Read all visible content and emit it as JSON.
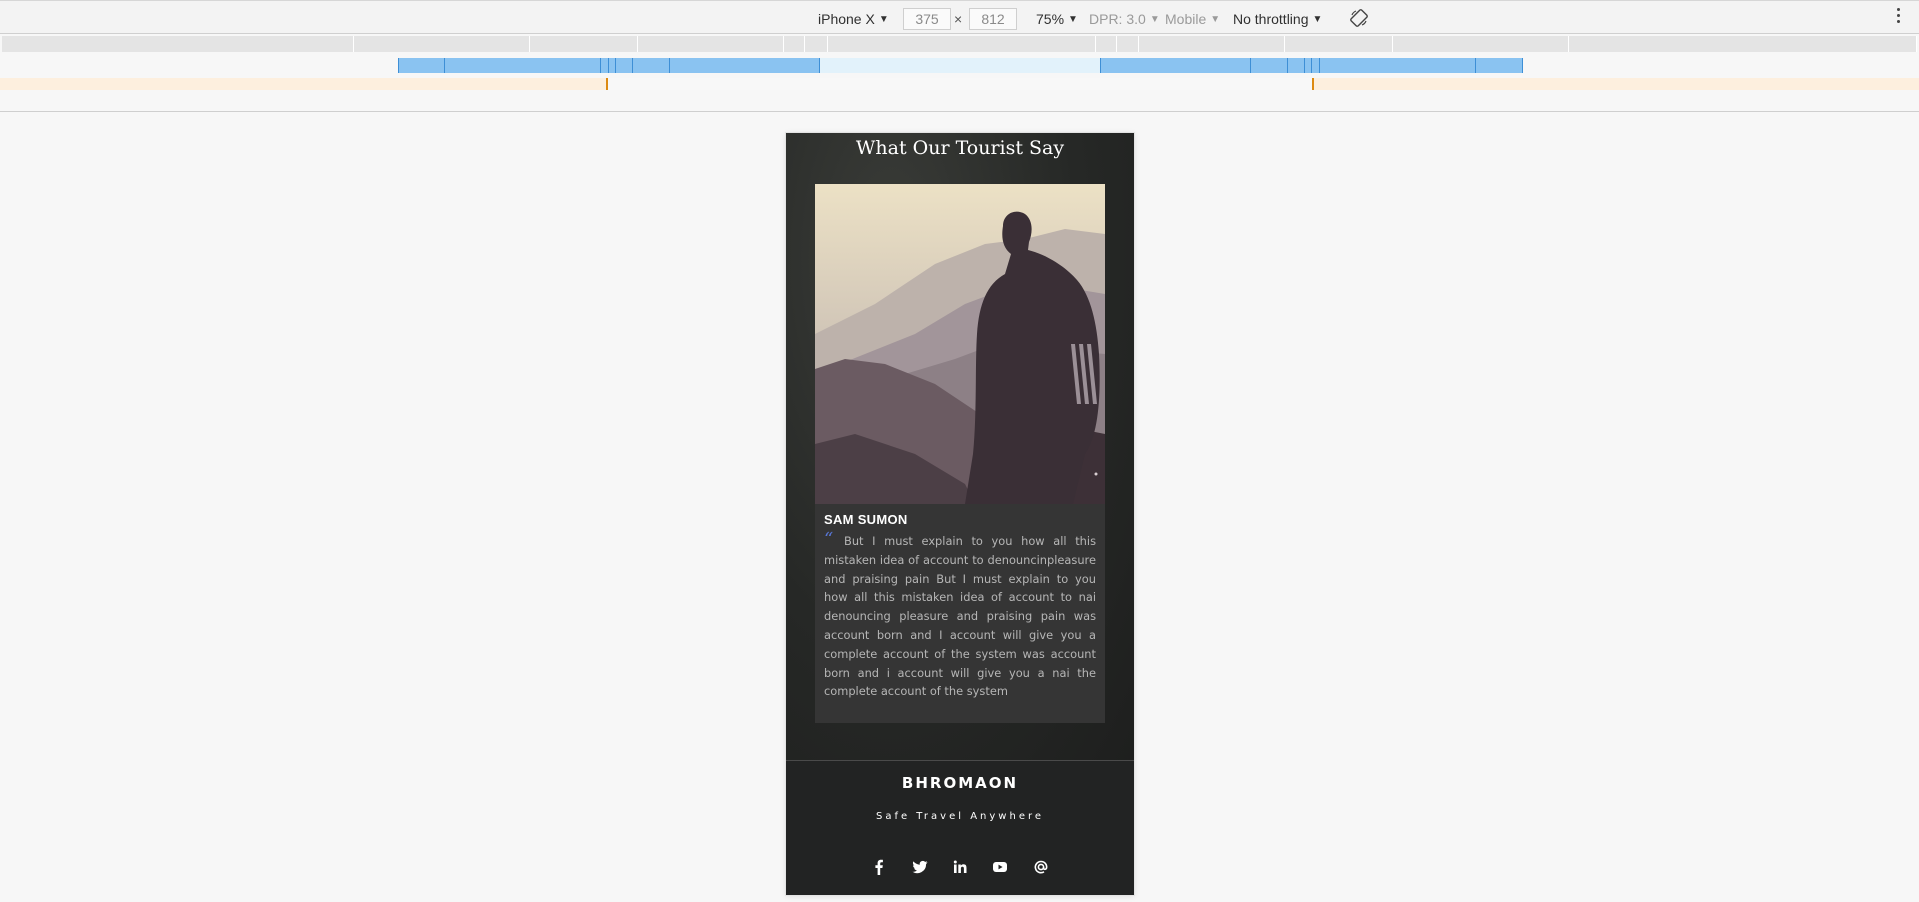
{
  "devtools": {
    "device": "iPhone X",
    "width": "375",
    "height": "812",
    "dim_separator": "×",
    "zoom": "75%",
    "dpr": "DPR: 3.0",
    "mode": "Mobile",
    "throttling": "No throttling",
    "caret": "▼"
  },
  "icons": {
    "rotate": "rotate-icon",
    "more": "kebab-menu-icon",
    "social": [
      "facebook-icon",
      "twitter-icon",
      "linkedin-icon",
      "youtube-icon",
      "at-icon"
    ]
  },
  "colors": {
    "accent_quote": "#5876d6",
    "media_query_bar": "#8ac3f1",
    "orange_tick": "#dd8a12"
  },
  "page": {
    "testimonials": {
      "title": "What Our Tourist Say",
      "author": "SAM SUMON",
      "quote_mark": "“",
      "quote": "But I must explain to you how all this mistaken idea of account to denouncinpleasure and praising pain But I must explain to you how all this mistaken idea of account to nai denouncing pleasure and praising pain was account born and I account will give you a complete account of the system was account born and i account will give you a nai the complete account of the system"
    },
    "footer": {
      "brand": "BHROMAON",
      "tagline": "Safe Travel Anywhere"
    }
  }
}
